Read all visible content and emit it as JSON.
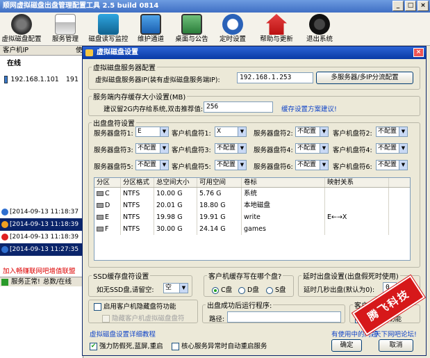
{
  "app": {
    "title": "顺网虚拟磁盘出盘管理配置工具 2.5 build 0814",
    "toolbar": [
      {
        "label": "虚拟磁盘配置",
        "icon": "gear-icon"
      },
      {
        "label": "服务管理",
        "icon": "printer-icon"
      },
      {
        "label": "磁盘读写监控",
        "icon": "monitor-icon"
      },
      {
        "label": "维护通道",
        "icon": "screen-icon"
      },
      {
        "label": "桌面与公告",
        "icon": "desktop-icon"
      },
      {
        "label": "定时设置",
        "icon": "clock-icon"
      },
      {
        "label": "帮助与更新",
        "icon": "home-icon"
      },
      {
        "label": "退出系统",
        "icon": "power-icon"
      }
    ]
  },
  "left_panel": {
    "header_col1": "客户机IP",
    "header_col2": "使",
    "online_label": "在线",
    "client_ip": "192.168.1.101",
    "client_extra": "191",
    "logs": [
      {
        "text": "[2014-09-13 11:18:37",
        "selected": false
      },
      {
        "text": "[2014-09-13 11:18:39",
        "selected": true
      },
      {
        "text": "[2014-09-13 11:18:39",
        "selected": false
      },
      {
        "text": "[2014-09-13 11:27:35",
        "selected": true
      }
    ],
    "ad_text": "加入畅赚联网吧增值联盟",
    "status_text": "服务正常!",
    "status_total": "总数/在线"
  },
  "dialog": {
    "title": "虚拟磁盘设置",
    "server_group": {
      "legend": "虚拟磁盘服务器配置",
      "ip_label": "虚拟磁盘服务器IP(装有虚拟磁盘服务端IP):",
      "ip_value": "192.168.1.253",
      "multi_button": "多服务器/多IP分流配置"
    },
    "cache_group": {
      "legend": "服务端内存缓存大小设置(MB)",
      "tip": "建议留2G内存给系统,双击推荐值:",
      "value": "256",
      "link": "缓存设置方案建议!"
    },
    "drive_group": {
      "legend": "出盘盘符设置",
      "server_label_prefix": "服务器盘符",
      "client_label_prefix": "客户机盘符",
      "rows": [
        [
          {
            "n": "1:",
            "s": "E",
            "c": "X"
          },
          {
            "n": "2:",
            "s": "不配置",
            "c": "不配置"
          }
        ],
        [
          {
            "n": "3:",
            "s": "不配置",
            "c": "不配置"
          },
          {
            "n": "4:",
            "s": "不配置",
            "c": "不配置"
          }
        ],
        [
          {
            "n": "5:",
            "s": "不配置",
            "c": "不配置"
          },
          {
            "n": "6:",
            "s": "不配置",
            "c": "不配置"
          }
        ]
      ]
    },
    "table": {
      "columns": [
        "分区",
        "分区格式",
        "总空间大小",
        "可用空间",
        "卷标",
        "映射关系"
      ],
      "rows": [
        [
          "C",
          "NTFS",
          "10.00 G",
          "5.76 G",
          "系统",
          ""
        ],
        [
          "D",
          "NTFS",
          "20.01 G",
          "18.80 G",
          "本地磁盘",
          ""
        ],
        [
          "E",
          "NTFS",
          "19.98 G",
          "19.91 G",
          "write",
          "E←→X"
        ],
        [
          "F",
          "NTFS",
          "30.00 G",
          "24.14 G",
          "games",
          ""
        ]
      ]
    },
    "ssd_group": {
      "legend": "SSD缓存盘符设置",
      "label": "如无SSD盘,请留空:",
      "value": "空"
    },
    "client_cache_group": {
      "legend": "客户机缓存写在哪个盘?",
      "options": [
        "C盘",
        "D盘",
        "S盘"
      ],
      "selected": 0
    },
    "delay_group": {
      "legend": "延时出盘设置(出盘假死时使用)",
      "label": "延时几秒出盘(默认为0):",
      "value": "0"
    },
    "hide_group": {
      "legend_check": "启用客户机隐藏盘符功能",
      "inner_check": "隐藏客户机虚拟磁盘盘符"
    },
    "run_group": {
      "legend": "出盘成功后运行程序:",
      "path_label": "路径:"
    },
    "client_out_group": {
      "legend": "客户端出",
      "check": "功能"
    },
    "detail_link": "虚拟磁盘设置详细教程",
    "faq_link": "有使用中的问题",
    "forum_link": "天下网吧论坛!",
    "bottom_checks": [
      "强力防假死,蓝屏,重启",
      "核心服务异常时自动重启服务"
    ],
    "ok_button": "确定",
    "cancel_button": "取消"
  },
  "stamp_text": "腾飞科技",
  "colors": {
    "accent": "#1044c8",
    "stamp": "#d6181a",
    "title": "#0a3aa5"
  }
}
